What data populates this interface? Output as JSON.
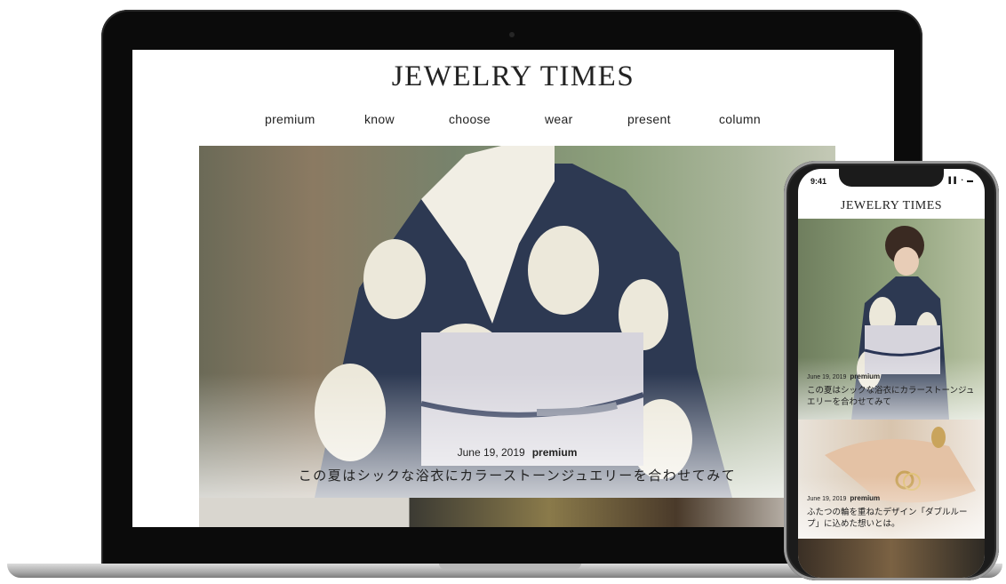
{
  "site": {
    "title": "JEWELRY TIMES"
  },
  "nav": {
    "items": [
      "premium",
      "know",
      "choose",
      "wear",
      "present",
      "column"
    ]
  },
  "hero": {
    "date": "June 19, 2019",
    "category": "premium",
    "headline": "この夏はシックな浴衣にカラーストーンジュエリーを合わせてみて"
  },
  "phone": {
    "status_time": "9:41",
    "status_icons": "▐▐ ◔ ▬",
    "title": "JEWELRY TIMES",
    "articles": [
      {
        "date": "June 19, 2019",
        "category": "premium",
        "headline": "この夏はシックな浴衣にカラーストーンジュエリーを合わせてみて"
      },
      {
        "date": "June 19, 2019",
        "category": "premium",
        "headline": "ふたつの輪を重ねたデザイン「ダブルループ」に込めた想いとは。"
      }
    ]
  },
  "colors": {
    "text": "#222222",
    "frame": "#0b0b0b",
    "background": "#ffffff"
  }
}
